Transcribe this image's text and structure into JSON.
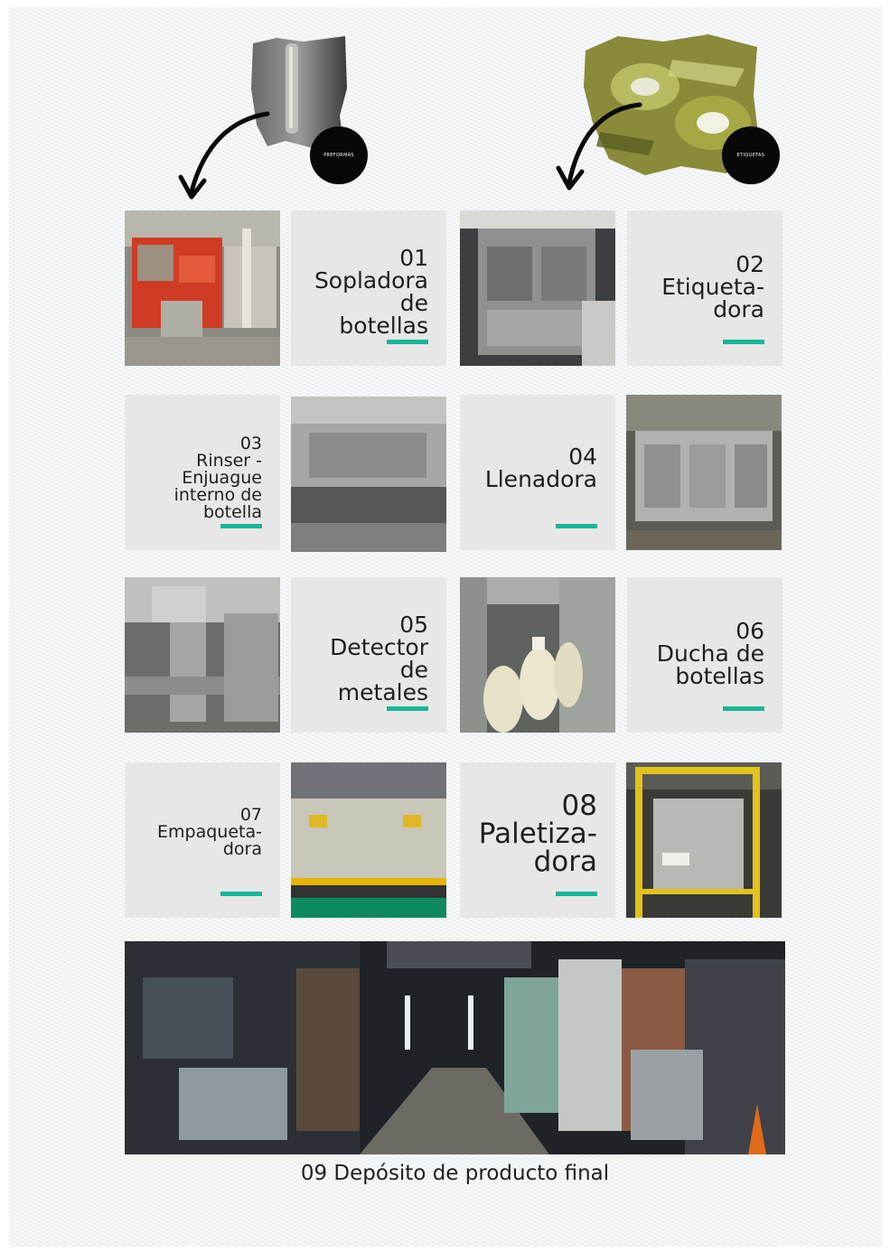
{
  "badges": {
    "preformas": "PREFORMAS",
    "etiquetas": "ETIQUETAS"
  },
  "icons": {
    "left_arrow": "curved-arrow-down-icon",
    "right_arrow": "curved-arrow-down-icon"
  },
  "colors": {
    "accent": "#17b596",
    "tile_background": "#e7e7e7",
    "text": "#1f1f1f",
    "badge": "#080808"
  },
  "steps": [
    {
      "number": "01",
      "name": "Sopladora\nde\nbotellas"
    },
    {
      "number": "02",
      "name": "Etiqueta-\ndora"
    },
    {
      "number": "03",
      "name": "Rinser -\nEnjuague\ninterno de\nbotella"
    },
    {
      "number": "04",
      "name": "Llenadora"
    },
    {
      "number": "05",
      "name": "Detector\nde\nmetales"
    },
    {
      "number": "06",
      "name": "Ducha de\nbotellas"
    },
    {
      "number": "07",
      "name": "Empaqueta-\ndora"
    },
    {
      "number": "08",
      "name": "Paletiza-\ndora"
    }
  ],
  "final_step": {
    "caption": "09 Depósito de producto final"
  }
}
